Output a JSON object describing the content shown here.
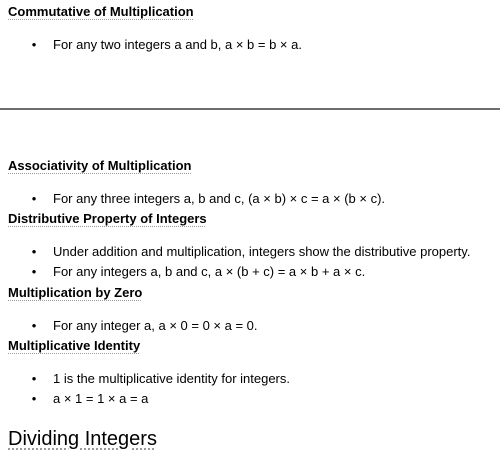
{
  "sections": [
    {
      "heading": "Commutative of Multiplication",
      "items": [
        "For any two integers a and b, a × b = b × a."
      ]
    },
    {
      "heading": "Associativity of Multiplication",
      "items": [
        "For any three integers a, b and c, (a × b) × c = a × (b × c)."
      ]
    },
    {
      "heading": "Distributive Property of Integers",
      "items": [
        "Under addition and multiplication, integers show the distributive property.",
        "For any integers a, b and c, a × (b + c) = a × b + a × c."
      ]
    },
    {
      "heading": "Multiplication by Zero",
      "items": [
        "For any integer a, a × 0 = 0 × a = 0."
      ]
    },
    {
      "heading": "Multiplicative Identity",
      "items": [
        "1 is the multiplicative identity for integers.",
        "a × 1 = 1 × a = a"
      ]
    }
  ],
  "next_heading": "Dividing Integers",
  "bullet_glyph": "•"
}
